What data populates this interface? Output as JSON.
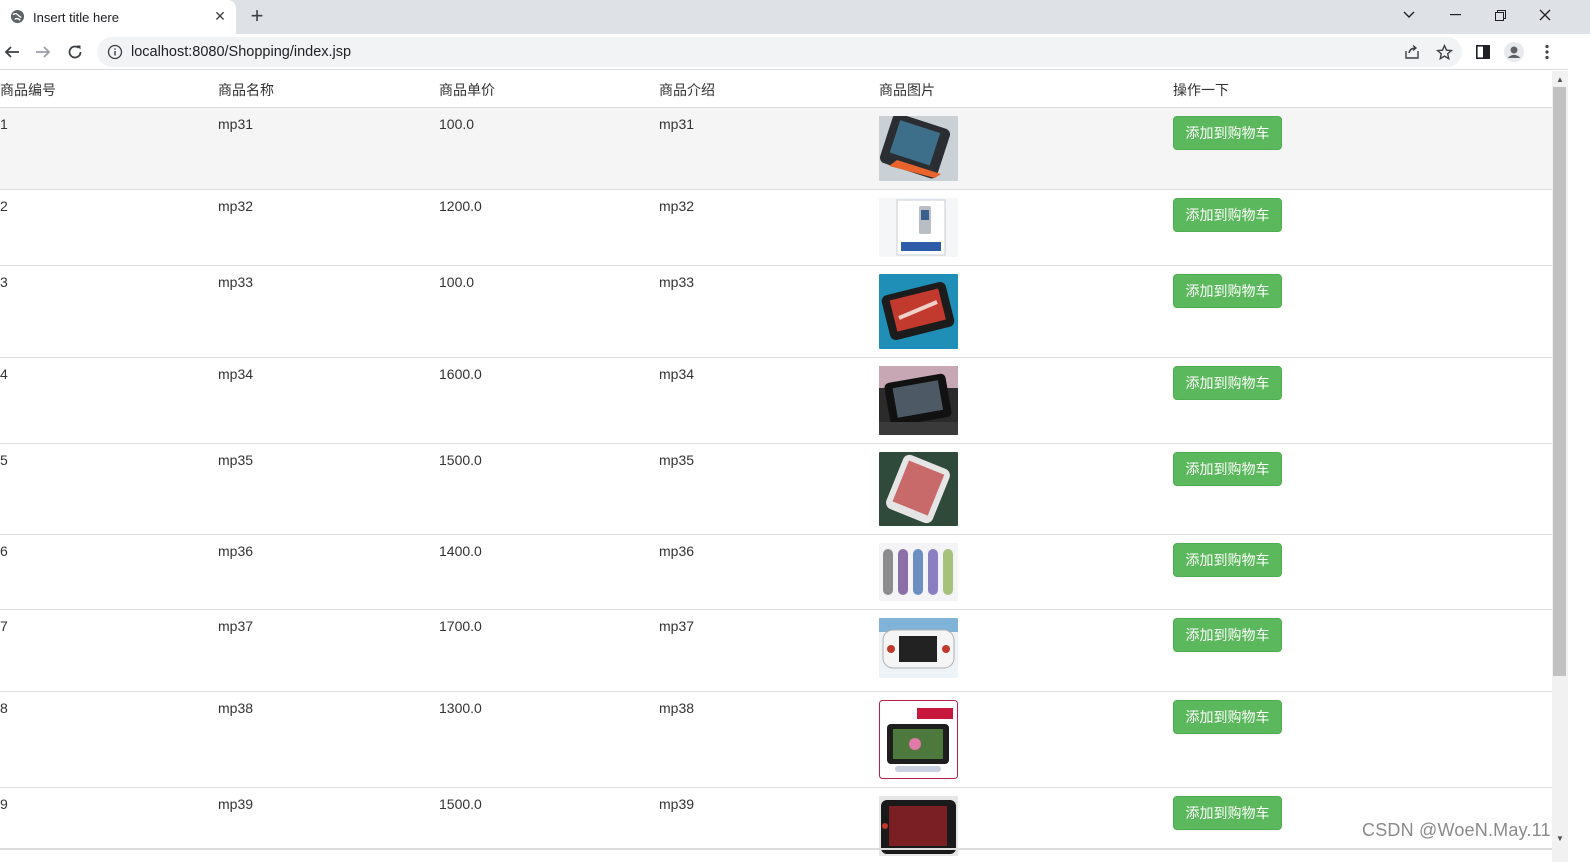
{
  "browser": {
    "tab_title": "Insert title here",
    "url": "localhost:8080/Shopping/index.jsp"
  },
  "table": {
    "headers": [
      "商品编号",
      "商品名称",
      "商品单价",
      "商品介绍",
      "商品图片",
      "操作一下"
    ],
    "button_label": "添加到购物车",
    "rows": [
      {
        "id": "1",
        "name": "mp31",
        "price": "100.0",
        "desc": "mp31"
      },
      {
        "id": "2",
        "name": "mp32",
        "price": "1200.0",
        "desc": "mp32"
      },
      {
        "id": "3",
        "name": "mp33",
        "price": "100.0",
        "desc": "mp33"
      },
      {
        "id": "4",
        "name": "mp34",
        "price": "1600.0",
        "desc": "mp34"
      },
      {
        "id": "5",
        "name": "mp35",
        "price": "1500.0",
        "desc": "mp35"
      },
      {
        "id": "6",
        "name": "mp36",
        "price": "1400.0",
        "desc": "mp36"
      },
      {
        "id": "7",
        "name": "mp37",
        "price": "1700.0",
        "desc": "mp37"
      },
      {
        "id": "8",
        "name": "mp38",
        "price": "1300.0",
        "desc": "mp38"
      },
      {
        "id": "9",
        "name": "mp39",
        "price": "1500.0",
        "desc": "mp39"
      }
    ]
  },
  "watermark": "CSDN @WoeN.May.11",
  "colors": {
    "button": "#5cb85c",
    "stripe": "#f5f5f5",
    "chrome": "#dee1e6"
  }
}
